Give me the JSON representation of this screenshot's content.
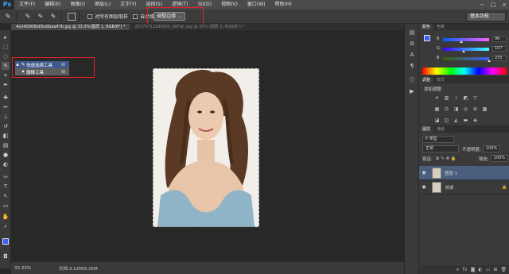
{
  "app": {
    "logo": "Ps",
    "menu": [
      "文件(F)",
      "编辑(E)",
      "图像(I)",
      "图层(L)",
      "文字(Y)",
      "选择(S)",
      "滤镜(T)",
      "3D(D)",
      "视图(V)",
      "窗口(W)",
      "帮助(H)"
    ],
    "window_controls": [
      "−",
      "□",
      "×"
    ]
  },
  "options_bar": {
    "sample_all_layers": "对所有图层取样",
    "auto_enhance": "自动增强",
    "refine_edge": "调整边缘 ...",
    "workspace": "基本功能"
  },
  "tabs": [
    {
      "label": "4a340006b65a9baa47b.jpg @ 33.3%(图层 1, RGB/8*) *",
      "active": true
    },
    {
      "label": "20170712183000_8AFdC.jpg @ 25% (图层 2, RGB/8*) *",
      "active": false
    }
  ],
  "tool_flyout": {
    "items": [
      {
        "label": "快速选择工具",
        "key": "W",
        "selected": true,
        "icon": "quick-selection-icon"
      },
      {
        "label": "魔棒工具",
        "key": "W",
        "selected": false,
        "icon": "magic-wand-icon"
      }
    ]
  },
  "status": {
    "zoom": "33.33%",
    "doc_size": "文档:3.12M/6.25M"
  },
  "color_panel": {
    "tabs": [
      "颜色",
      "色板"
    ],
    "foreground": "#3c5fff",
    "channels": [
      {
        "label": "R",
        "value": "96"
      },
      {
        "label": "G",
        "value": "107"
      },
      {
        "label": "B",
        "value": "255"
      }
    ]
  },
  "adjustments_panel": {
    "tabs": [
      "调整",
      "样式"
    ],
    "title": "添加调整"
  },
  "layers_panel": {
    "tabs": [
      "图层",
      "通道"
    ],
    "filter": "P 类型",
    "blend_mode": "正常",
    "opacity_label": "不透明度:",
    "opacity": "100%",
    "lock_label": "锁定:",
    "fill_label": "填充:",
    "fill": "100%",
    "layers": [
      {
        "name": "图层 1",
        "selected": true,
        "visible": true
      },
      {
        "name": "背景",
        "selected": false,
        "visible": true,
        "locked": true
      }
    ]
  }
}
